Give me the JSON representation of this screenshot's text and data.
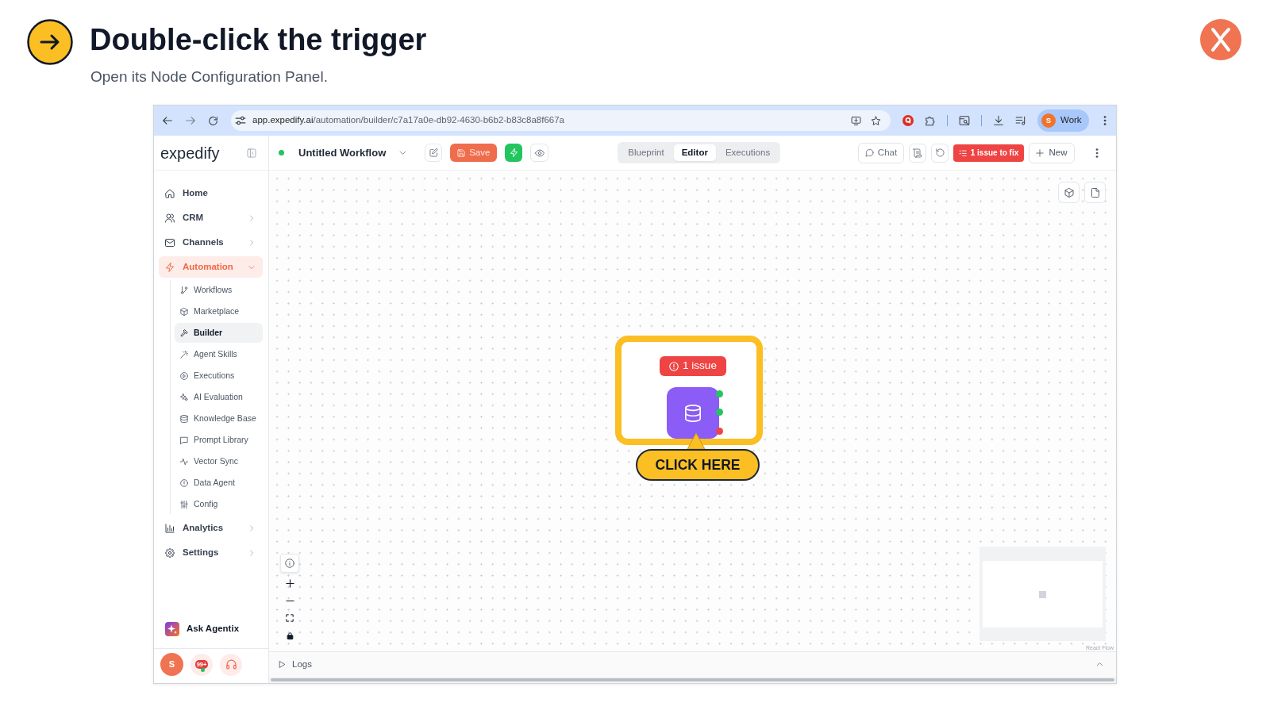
{
  "slide": {
    "title": "Double-click the trigger",
    "subtitle": "Open its Node Configuration Panel."
  },
  "browser": {
    "url_host": "app.expedify.ai",
    "url_path": "/automation/builder/c7a17a0e-db92-4630-b6b2-b83c8a8f667a",
    "profile": {
      "initial": "S",
      "label": "Work"
    }
  },
  "sidebar": {
    "logo": "expedify",
    "items": [
      {
        "label": "Home",
        "kind": "link",
        "selected": false
      },
      {
        "label": "CRM",
        "kind": "group",
        "selected": false,
        "expanded": false
      },
      {
        "label": "Channels",
        "kind": "group",
        "selected": false,
        "expanded": false
      },
      {
        "label": "Automation",
        "kind": "group",
        "selected": true,
        "expanded": true,
        "children": [
          {
            "label": "Workflows",
            "selected": false
          },
          {
            "label": "Marketplace",
            "selected": false
          },
          {
            "label": "Builder",
            "selected": true
          },
          {
            "label": "Agent Skills",
            "selected": false
          },
          {
            "label": "Executions",
            "selected": false
          },
          {
            "label": "AI Evaluation",
            "selected": false
          },
          {
            "label": "Knowledge Base",
            "selected": false
          },
          {
            "label": "Prompt Library",
            "selected": false
          },
          {
            "label": "Vector Sync",
            "selected": false
          },
          {
            "label": "Data Agent",
            "selected": false
          },
          {
            "label": "Config",
            "selected": false
          }
        ]
      },
      {
        "label": "Analytics",
        "kind": "group",
        "selected": false,
        "expanded": false
      },
      {
        "label": "Settings",
        "kind": "group",
        "selected": false,
        "expanded": false
      }
    ],
    "assistant": "Ask Agentix",
    "user_initial": "S",
    "notification_count": "99+"
  },
  "header": {
    "workflow_name": "Untitled Workflow",
    "save_label": "Save",
    "view_tabs": [
      {
        "label": "Blueprint",
        "selected": false
      },
      {
        "label": "Editor",
        "selected": true
      },
      {
        "label": "Executions",
        "selected": false
      }
    ],
    "chat_label": "Chat",
    "issues_label": "1 issue to fix",
    "new_label": "New"
  },
  "canvas": {
    "node": {
      "issue_badge": "1 issue",
      "handles": [
        {
          "color": "#22c55e"
        },
        {
          "color": "#22c55e"
        },
        {
          "color": "#ef4444"
        }
      ]
    },
    "callout": "CLICK HERE",
    "attribution": "React Flow"
  },
  "logs": {
    "label": "Logs"
  }
}
